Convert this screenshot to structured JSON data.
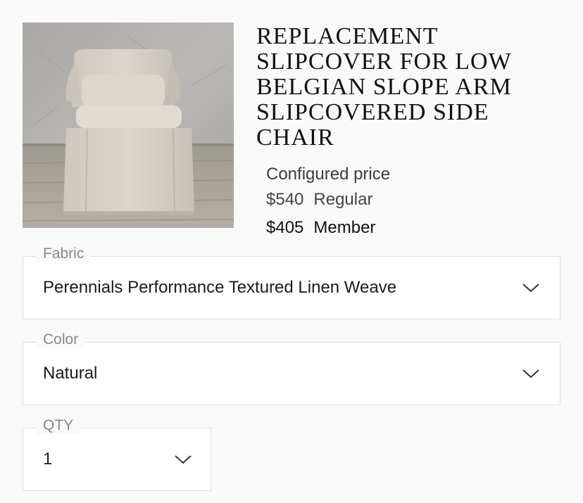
{
  "product": {
    "title": "REPLACEMENT SLIPCOVER FOR LOW BELGIAN SLOPE ARM SLIPCOVERED SIDE CHAIR",
    "image_icon": "chair-photo"
  },
  "pricing": {
    "caption": "Configured price",
    "regular_amount": "$540",
    "regular_label": "Regular",
    "member_amount": "$405",
    "member_label": "Member"
  },
  "options": {
    "fabric": {
      "label": "Fabric",
      "value": "Perennials Performance Textured Linen Weave"
    },
    "color": {
      "label": "Color",
      "value": "Natural"
    },
    "qty": {
      "label": "QTY",
      "value": "1"
    }
  },
  "icons": {
    "dropdown": "chevron-down-icon"
  },
  "colors": {
    "background": "#f9f9f9",
    "field_background": "#ffffff",
    "field_border": "#dedede",
    "legend_text": "#888888",
    "text": "#1b1b1b"
  }
}
